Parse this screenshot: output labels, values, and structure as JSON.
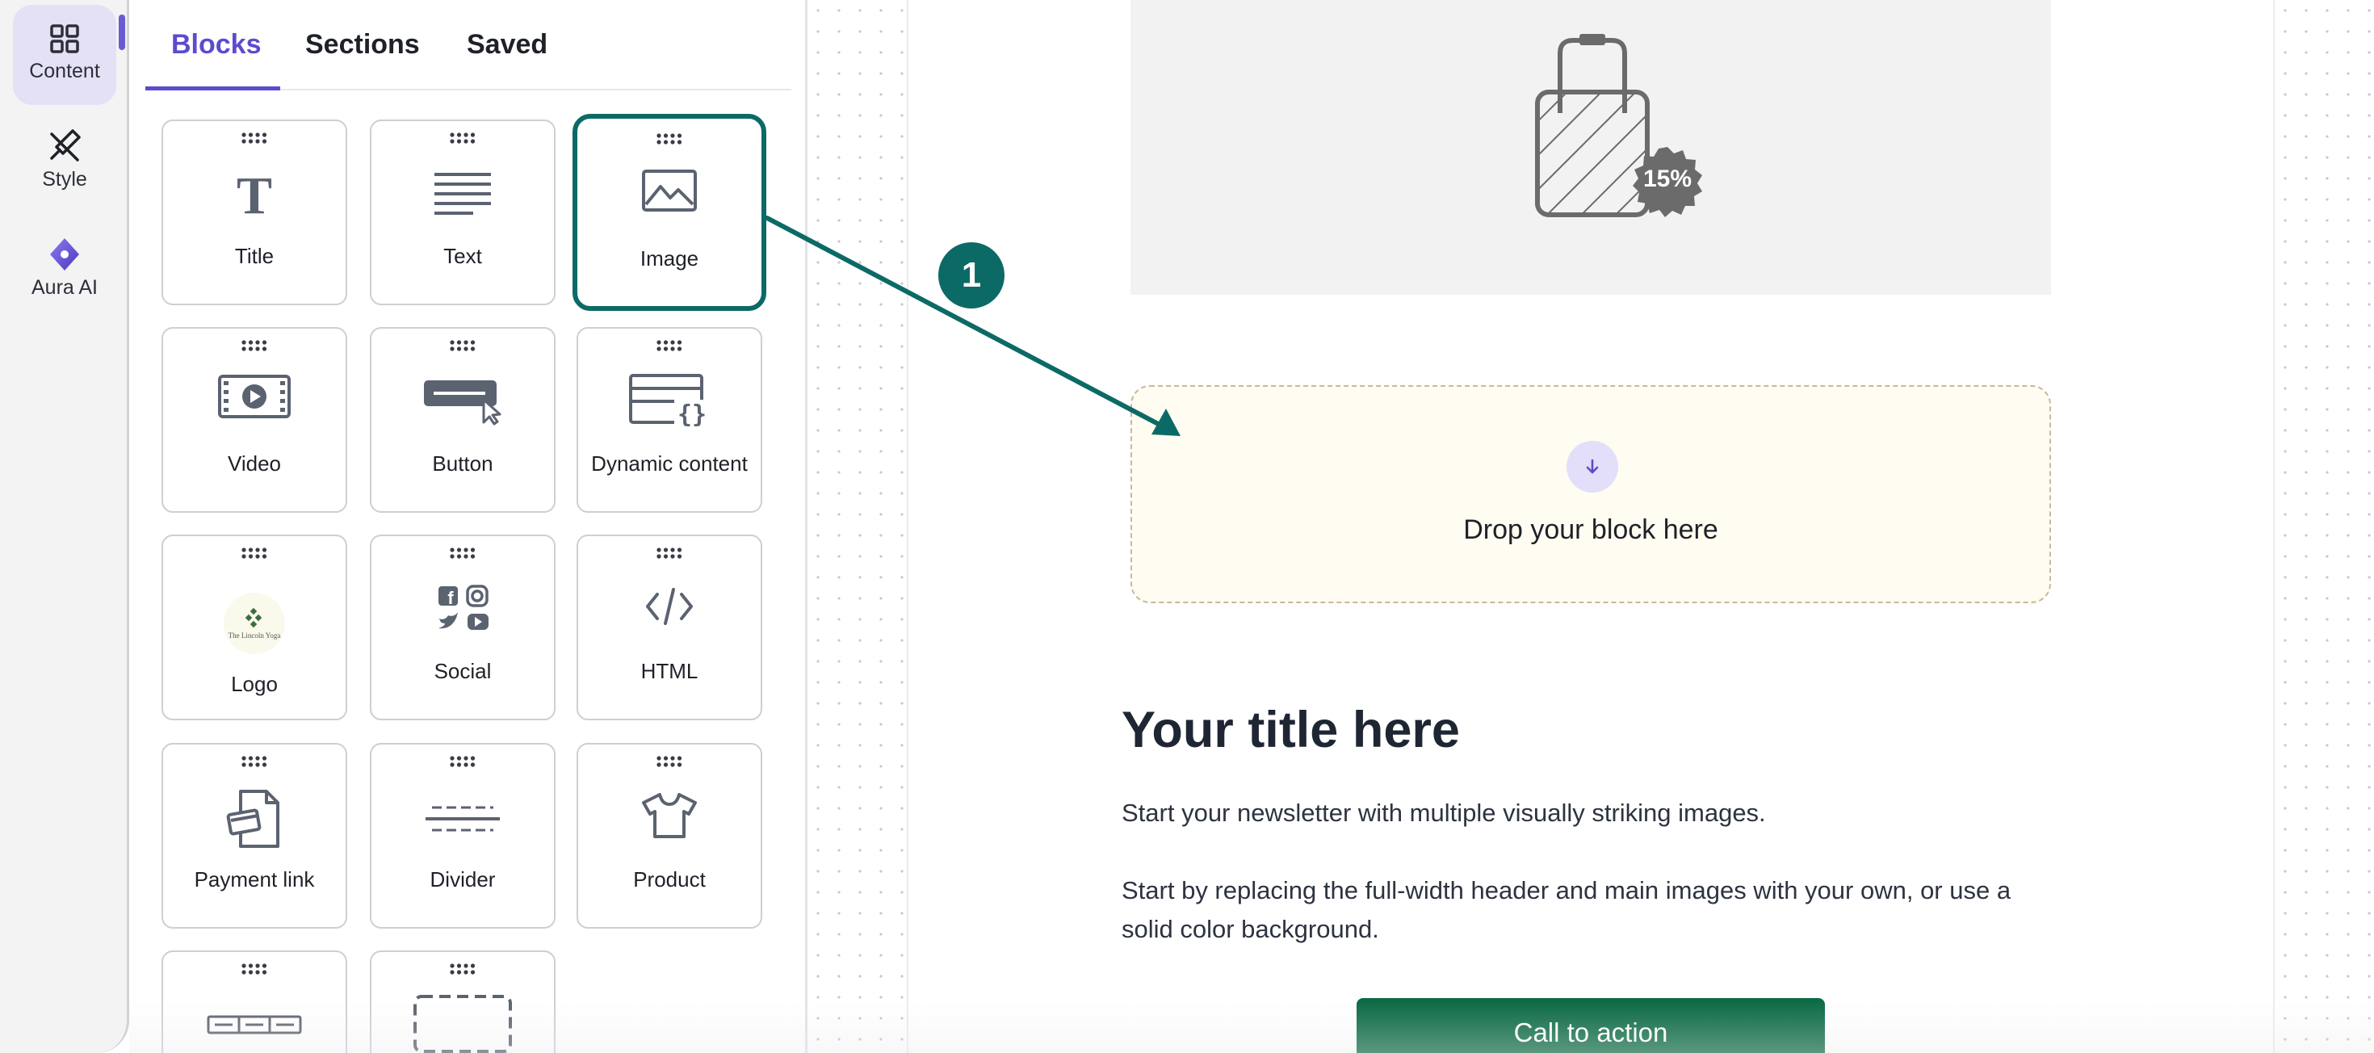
{
  "rail": {
    "items": [
      {
        "label": "Content",
        "icon": "grid-icon"
      },
      {
        "label": "Style",
        "icon": "brush-icon"
      },
      {
        "label": "Aura AI",
        "icon": "sparkle-icon"
      }
    ],
    "accent": "#6a5bd4"
  },
  "tabs": [
    {
      "label": "Blocks"
    },
    {
      "label": "Sections"
    },
    {
      "label": "Saved"
    }
  ],
  "blocks": [
    {
      "label": "Title",
      "icon": "title-icon"
    },
    {
      "label": "Text",
      "icon": "text-lines-icon"
    },
    {
      "label": "Image",
      "icon": "image-icon"
    },
    {
      "label": "Video",
      "icon": "video-icon"
    },
    {
      "label": "Button",
      "icon": "button-cursor-icon"
    },
    {
      "label": "Dynamic content",
      "icon": "dynamic-content-icon"
    },
    {
      "label": "Logo",
      "icon": "logo-icon",
      "logo_text": "The Lincoln Yoga"
    },
    {
      "label": "Social",
      "icon": "social-icons"
    },
    {
      "label": "HTML",
      "icon": "code-icon"
    },
    {
      "label": "Payment link",
      "icon": "payment-icon"
    },
    {
      "label": "Divider",
      "icon": "divider-icon"
    },
    {
      "label": "Product",
      "icon": "tshirt-icon"
    },
    {
      "label": "",
      "icon": "navigation-icon"
    },
    {
      "label": "",
      "icon": "spacer-icon"
    }
  ],
  "canvas": {
    "discount_badge": "15%",
    "drop_text": "Drop your block here",
    "title": "Your title here",
    "paragraph_1": "Start your newsletter with multiple visually striking images.",
    "paragraph_2": "Start by replacing the full-width header and main images with your own, or use a solid color background.",
    "cta_label": "Call to action",
    "cta_color": "#0d6b45"
  },
  "annotation": {
    "step": "1",
    "color": "#0c6a66"
  }
}
